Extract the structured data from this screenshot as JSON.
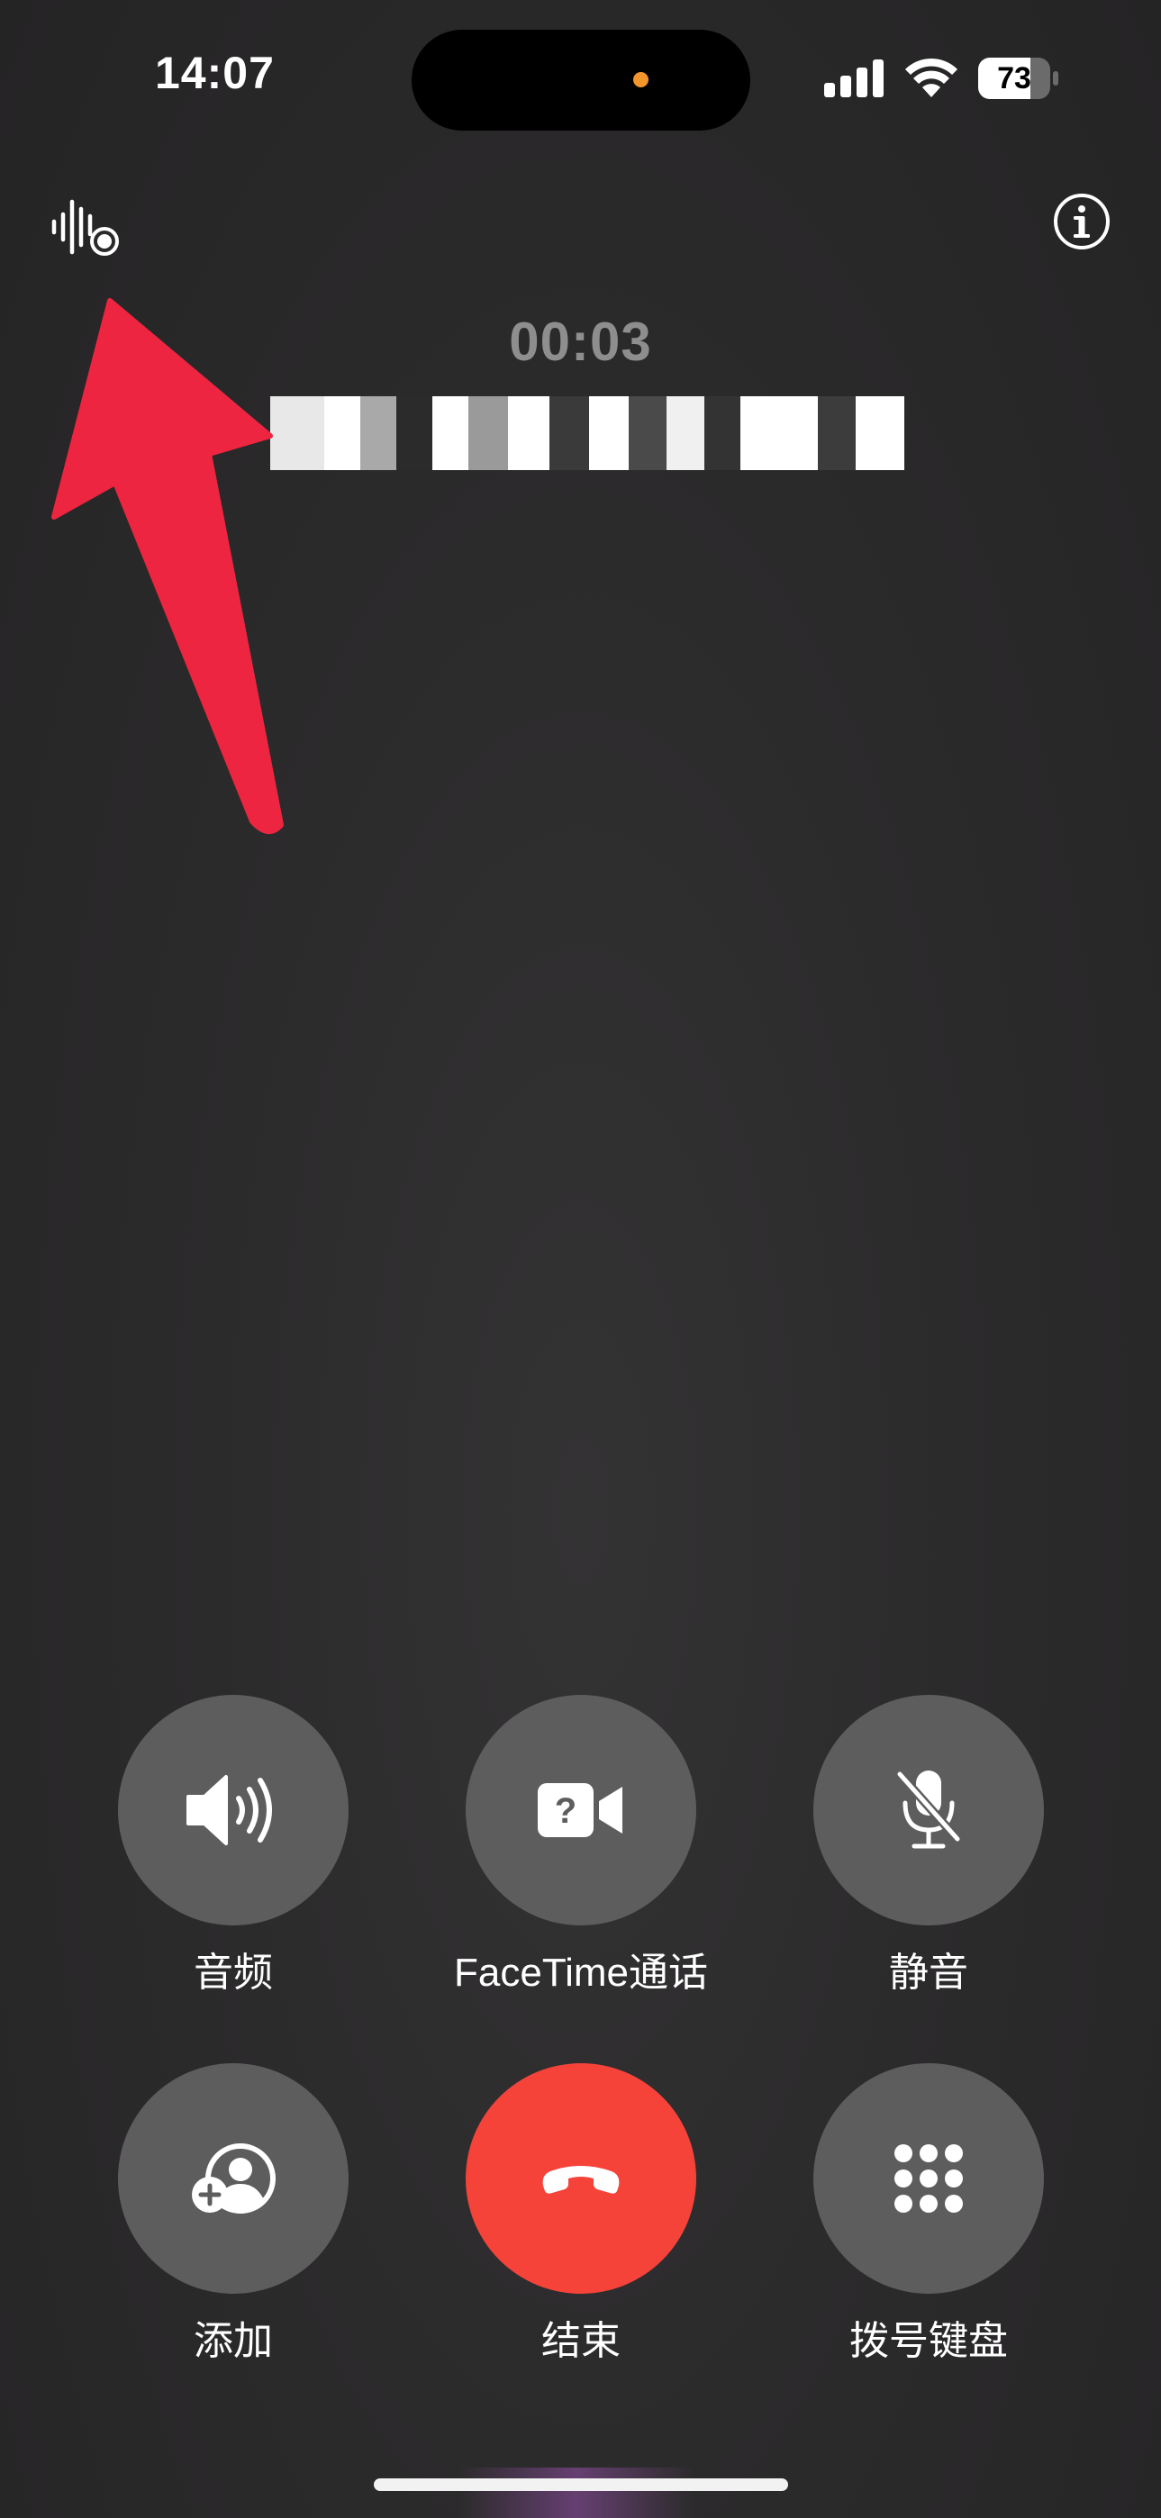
{
  "status_bar": {
    "time": "14:07",
    "battery_level": "73",
    "battery_fraction": 0.73,
    "privacy_dot_color": "#f2952a"
  },
  "top_controls": {
    "left_icon": "call-recording-icon",
    "right_icon": "info-icon"
  },
  "call": {
    "duration": "00:03"
  },
  "annotation": {
    "arrow_color": "#ee2540"
  },
  "controls": [
    {
      "label": "音频",
      "icon": "speaker-icon"
    },
    {
      "label": "FaceTime通话",
      "icon": "facetime-video-icon"
    },
    {
      "label": "静音",
      "icon": "mute-mic-icon"
    },
    {
      "label": "添加",
      "icon": "add-person-icon"
    },
    {
      "label": "结束",
      "icon": "end-call-icon",
      "color": "#f5433a"
    },
    {
      "label": "拨号键盘",
      "icon": "keypad-icon"
    }
  ]
}
